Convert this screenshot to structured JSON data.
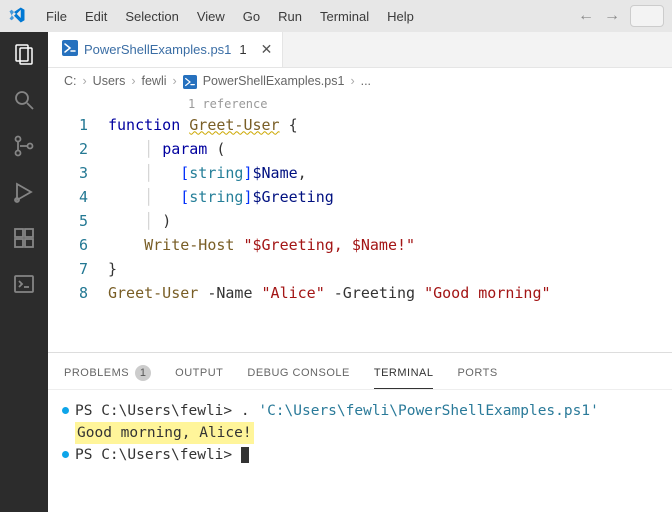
{
  "menu": [
    "File",
    "Edit",
    "Selection",
    "View",
    "Go",
    "Run",
    "Terminal",
    "Help"
  ],
  "tab": {
    "name": "PowerShellExamples.ps1",
    "dirty": "1"
  },
  "crumbs": {
    "c0": "C:",
    "c1": "Users",
    "c2": "fewli",
    "c3": "PowerShellExamples.ps1",
    "c4": "..."
  },
  "codelens": "1 reference",
  "lines": {
    "l1": {
      "n": "1",
      "a": "function ",
      "b": "Greet-User",
      "c": " {"
    },
    "l2": {
      "n": "2",
      "a": "param",
      "b": " ("
    },
    "l3": {
      "n": "3",
      "a": "[",
      "b": "string",
      "c": "]",
      "d": "$Name",
      "e": ","
    },
    "l4": {
      "n": "4",
      "a": "[",
      "b": "string",
      "c": "]",
      "d": "$Greeting"
    },
    "l5": {
      "n": "5",
      "a": ")"
    },
    "l6": {
      "n": "6",
      "a": "Write-Host",
      "b": " \"$Greeting, $Name!\""
    },
    "l7": {
      "n": "7",
      "a": "}"
    },
    "l8": {
      "n": "8",
      "a": "Greet-User",
      "b": " -Name ",
      "c": "\"Alice\"",
      "d": " -Greeting ",
      "e": "\"Good morning\""
    }
  },
  "panel": {
    "problems": "PROBLEMS",
    "problems_badge": "1",
    "output": "OUTPUT",
    "debug": "DEBUG CONSOLE",
    "terminal": "TERMINAL",
    "ports": "PORTS"
  },
  "term": {
    "p1": "PS C:\\Users\\fewli> ",
    "p1cmd": ". ",
    "p1str": "'C:\\Users\\fewli\\PowerShellExamples.ps1'",
    "out": "Good morning, Alice!",
    "p2": "PS C:\\Users\\fewli> "
  }
}
